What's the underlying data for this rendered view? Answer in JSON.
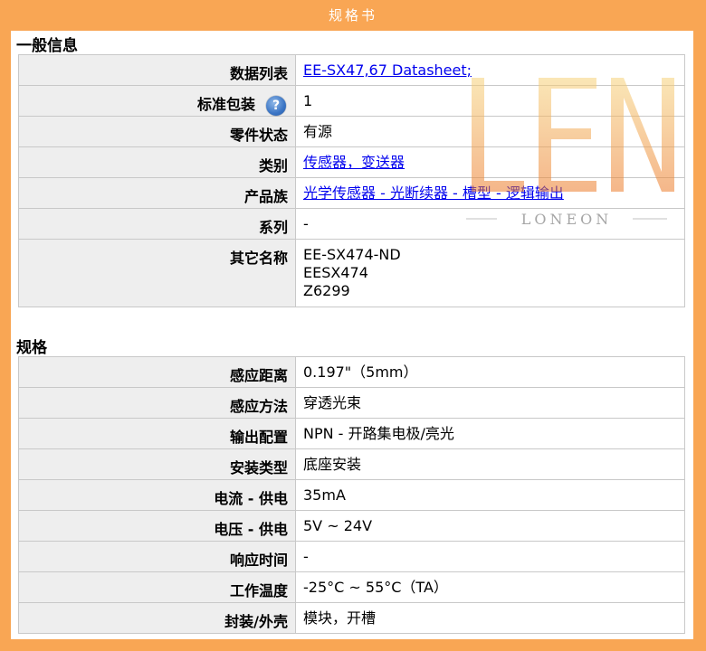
{
  "header": {
    "title": "规格书"
  },
  "general": {
    "title": "一般信息",
    "rows": [
      {
        "label": "数据列表",
        "values": [
          "EE-SX47,67 Datasheet;"
        ],
        "link": true
      },
      {
        "label": "标准包装",
        "values": [
          "1"
        ],
        "help": true,
        "help_glyph": "?"
      },
      {
        "label": "零件状态",
        "values": [
          "有源"
        ]
      },
      {
        "label": "类别",
        "values": [
          "传感器，变送器"
        ],
        "link": true
      },
      {
        "label": "产品族",
        "values": [
          "光学传感器 - 光断续器 - 槽型 - 逻辑输出"
        ],
        "link": true
      },
      {
        "label": "系列",
        "values": [
          "-"
        ]
      },
      {
        "label": "其它名称",
        "values": [
          "EE-SX474-ND",
          "EESX474",
          "Z6299"
        ]
      }
    ]
  },
  "specs": {
    "title": "规格",
    "rows": [
      {
        "label": "感应距离",
        "values": [
          "0.197\"（5mm）"
        ]
      },
      {
        "label": "感应方法",
        "values": [
          "穿透光束"
        ]
      },
      {
        "label": "输出配置",
        "values": [
          "NPN - 开路集电极/亮光"
        ]
      },
      {
        "label": "安装类型",
        "values": [
          "底座安装"
        ]
      },
      {
        "label": "电流 - 供电",
        "values": [
          "35mA"
        ]
      },
      {
        "label": "电压 - 供电",
        "values": [
          "5V ~ 24V"
        ]
      },
      {
        "label": "响应时间",
        "values": [
          "-"
        ]
      },
      {
        "label": "工作温度",
        "values": [
          "-25°C ~ 55°C（TA）"
        ]
      },
      {
        "label": "封装/外壳",
        "values": [
          "模块，开槽"
        ]
      }
    ]
  },
  "watermark": {
    "logo": "LEN",
    "sub": "LONEON"
  },
  "colors": {
    "frame": "#f9a654",
    "label_bg": "#eeeeee",
    "border": "#c8c8c8",
    "link": "#0000ee"
  }
}
